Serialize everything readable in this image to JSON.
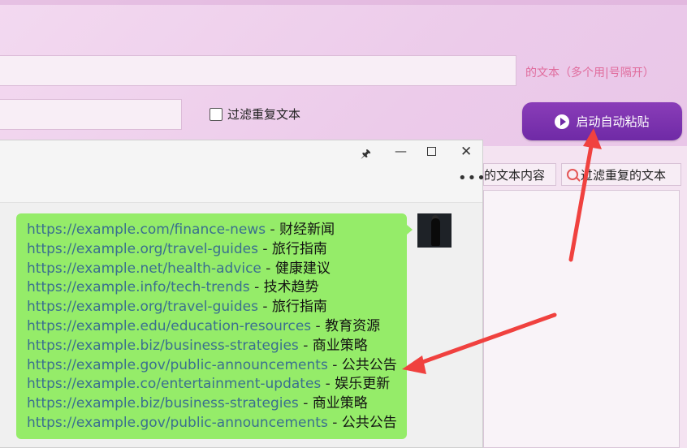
{
  "form": {
    "input_hint": "的文本（多个用|号隔开）",
    "filter_label": "过滤重复文本",
    "start_button": "启动自动粘贴"
  },
  "right_panel": {
    "tab1_label": "的文本内容",
    "tab2_label": "过滤重复的文本"
  },
  "chat": {
    "messages": [
      {
        "url": "https://example.com/finance-news",
        "label": "财经新闻"
      },
      {
        "url": "https://example.org/travel-guides",
        "label": "旅行指南"
      },
      {
        "url": "https://example.net/health-advice",
        "label": "健康建议"
      },
      {
        "url": "https://example.info/tech-trends",
        "label": "技术趋势"
      },
      {
        "url": "https://example.org/travel-guides",
        "label": "旅行指南"
      },
      {
        "url": "https://example.edu/education-resources",
        "label": "教育资源"
      },
      {
        "url": "https://example.biz/business-strategies",
        "label": "商业策略"
      },
      {
        "url": "https://example.gov/public-announcements",
        "label": "公共公告"
      },
      {
        "url": "https://example.co/entertainment-updates",
        "label": "娱乐更新"
      },
      {
        "url": "https://example.biz/business-strategies",
        "label": "商业策略"
      },
      {
        "url": "https://example.gov/public-announcements",
        "label": "公共公告"
      }
    ],
    "separator": "-"
  },
  "colors": {
    "bubble": "#95ec69",
    "button": "#6f2aa6",
    "arrow": "#f0413f",
    "hint": "#e06b9c"
  }
}
